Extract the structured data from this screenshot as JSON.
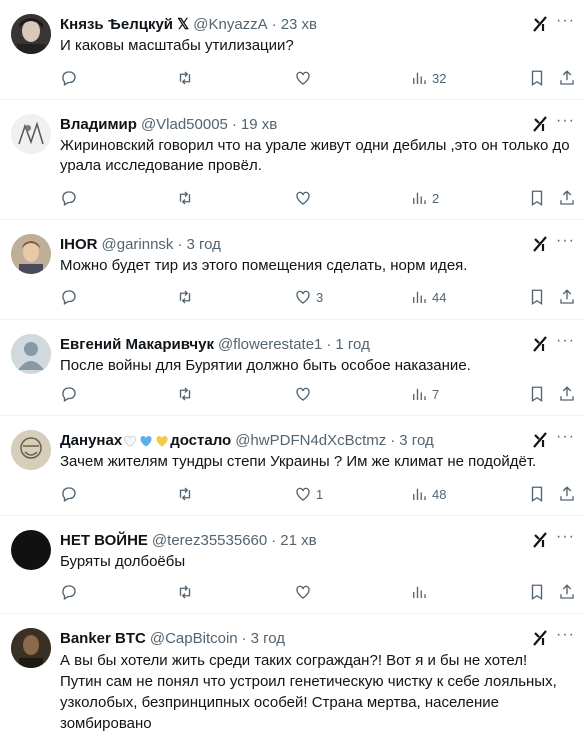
{
  "tweets": [
    {
      "name": "Князь Ѣелцкуй 𝕏",
      "handle": "@KnyazzA",
      "time": "23 хв",
      "text": "И каковы масштабы утилизации?",
      "replies": "",
      "retweets": "",
      "likes": "",
      "views": "32",
      "avatar": "avatar-dark-portrait"
    },
    {
      "name": "Владимир",
      "handle": "@Vlad50005",
      "time": "19 хв",
      "text": "Жириновский говорил что на урале живут одни дебилы ,это он только до урала исследование провёл.",
      "replies": "",
      "retweets": "",
      "likes": "",
      "views": "2",
      "avatar": "avatar-drawing"
    },
    {
      "name": "IHOR",
      "handle": "@garinnsk",
      "time": "3 год",
      "text": "Можно будет тир из этого помещения сделать, норм идея.",
      "replies": "",
      "retweets": "",
      "likes": "3",
      "views": "44",
      "avatar": "avatar-man-portrait"
    },
    {
      "name": "Евгений Макаривчук",
      "handle": "@flowerestate1",
      "time": "1 год",
      "text": "После войны для Бурятии должно быть особое наказание.",
      "replies": "",
      "retweets": "",
      "likes": "",
      "views": "7",
      "avatar": "avatar-default"
    },
    {
      "name_a": "Данунах",
      "name_b": "достало",
      "handle": "@hwPDFN4dXcBctmz",
      "time": "3 год",
      "text": "Зачем жителям тундры степи Украины ? Им же климат не подойдёт.",
      "replies": "",
      "retweets": "",
      "likes": "1",
      "views": "48",
      "avatar": "avatar-sketch"
    },
    {
      "name": "НЕТ ВОЙНЕ",
      "handle": "@terez35535660",
      "time": "21 хв",
      "text": "Буряты долбоёбы",
      "replies": "",
      "retweets": "",
      "likes": "",
      "views": "",
      "avatar": "avatar-black"
    },
    {
      "name": "Banker BTC",
      "handle": "@CapBitcoin",
      "time": "3 год",
      "text_lines": [
        "А вы бы хотели жить среди таких сограждан?! Вот я и бы не хотел!",
        "Путин сам не понял что устроил генетическую чистку к себе лояльных,",
        "узколобых, безпринципных особей! Страна мертва, население",
        "зомбировано"
      ],
      "avatar": "avatar-photo"
    }
  ],
  "colors": {
    "text": "#0f1419",
    "muted": "#536471",
    "divider": "#eff3f4"
  }
}
